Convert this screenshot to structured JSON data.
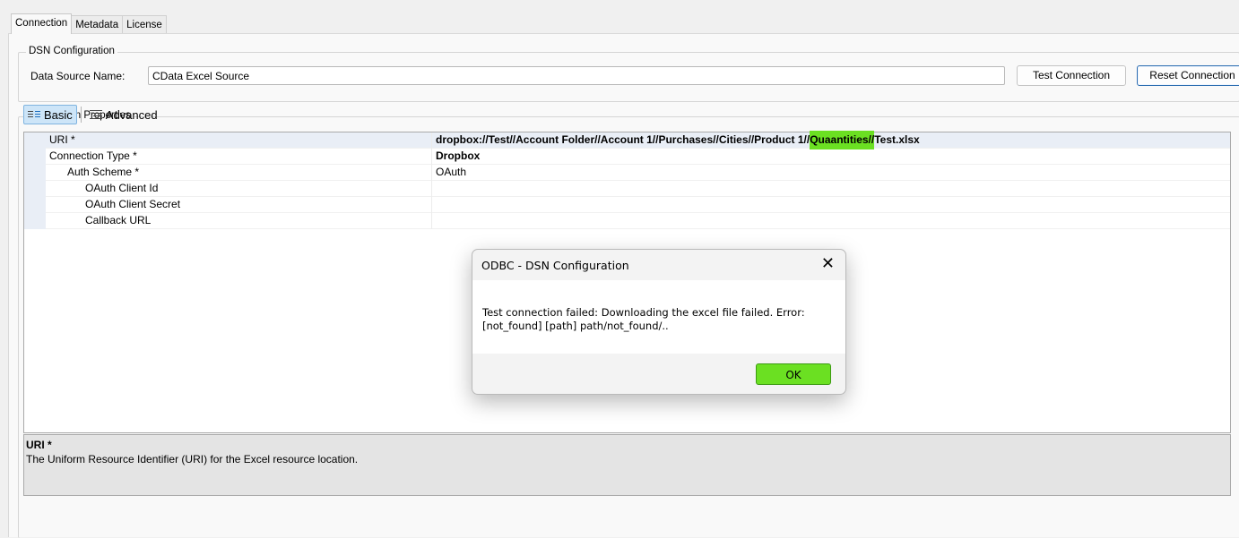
{
  "tabs": [
    {
      "label": "Connection",
      "active": true
    },
    {
      "label": "Metadata",
      "active": false
    },
    {
      "label": "License",
      "active": false
    }
  ],
  "dsn_config": {
    "legend": "DSN Configuration",
    "label": "Data Source Name:",
    "value": "CData Excel Source",
    "test_button": "Test Connection",
    "reset_button": "Reset Connection"
  },
  "connection_properties": {
    "legend": "Connection Properties",
    "views": {
      "basic": "Basic",
      "advanced": "Advanced"
    },
    "rows": [
      {
        "name": "URI *",
        "value_before": "dropbox://Test//Account  Folder//Account 1//Purchases//Cities//Product 1//",
        "value_highlight": "Quaantities//",
        "value_after": "Test.xlsx"
      },
      {
        "name": "Connection Type *",
        "value": "Dropbox"
      },
      {
        "name": "Auth Scheme *",
        "value": "OAuth"
      },
      {
        "name": "OAuth Client Id",
        "value": ""
      },
      {
        "name": "OAuth Client Secret",
        "value": ""
      },
      {
        "name": "Callback URL",
        "value": ""
      }
    ],
    "highlight_color": "#6be022"
  },
  "description": {
    "title": "URI *",
    "text": "The Uniform Resource Identifier (URI) for the Excel resource location."
  },
  "dialog": {
    "title": "ODBC - DSN Configuration",
    "message": "Test connection failed: Downloading the excel file failed. Error: [not_found] [path] path/not_found/..",
    "ok_button": "OK",
    "close_icon": "close-icon"
  }
}
